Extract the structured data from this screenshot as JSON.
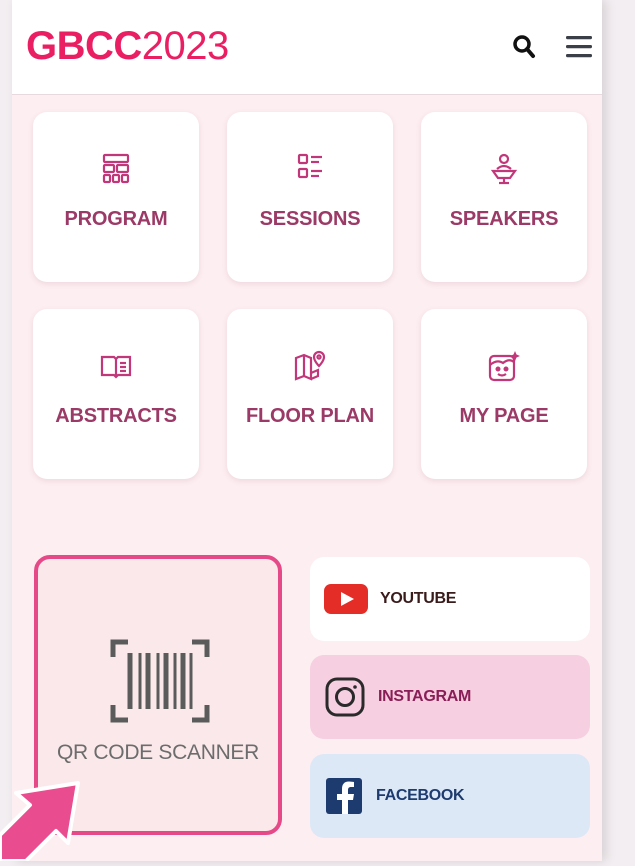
{
  "header": {
    "logo_bold": "GBCC",
    "logo_year": "2023",
    "search_icon": "search-icon",
    "menu_icon": "hamburger-menu-icon"
  },
  "tiles": [
    {
      "label": "PROGRAM",
      "icon": "program-grid-icon"
    },
    {
      "label": "SESSIONS",
      "icon": "sessions-list-icon"
    },
    {
      "label": "SPEAKERS",
      "icon": "speaker-podium-icon"
    },
    {
      "label": "ABSTRACTS",
      "icon": "open-book-icon"
    },
    {
      "label": "FLOOR PLAN",
      "icon": "map-pin-icon"
    },
    {
      "label": "MY PAGE",
      "icon": "profile-face-icon"
    }
  ],
  "qr": {
    "label": "QR CODE SCANNER",
    "icon": "barcode-scan-icon"
  },
  "social": [
    {
      "label": "YOUTUBE",
      "icon": "youtube-icon"
    },
    {
      "label": "INSTAGRAM",
      "icon": "instagram-icon"
    },
    {
      "label": "FACEBOOK",
      "icon": "facebook-icon"
    }
  ],
  "colors": {
    "brand": "#ea1f63",
    "tile_text": "#9b3a66",
    "qr_border": "#e64988",
    "youtube_red": "#e52d27",
    "facebook_blue": "#1d3b6e"
  }
}
